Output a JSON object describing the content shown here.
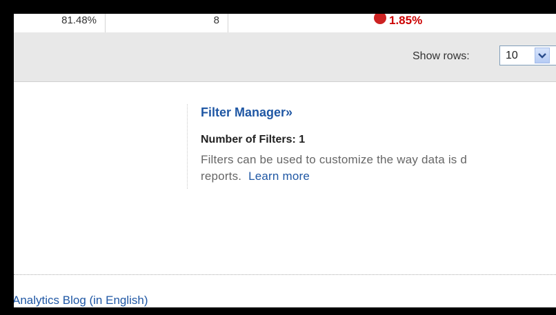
{
  "table_row": {
    "col1_value": "81.48%",
    "col2_value": "8",
    "col3_value": "1.85%",
    "col3_color": "#cc0000"
  },
  "pager": {
    "show_rows_label": "Show rows:",
    "rows_value": "10"
  },
  "filter_manager": {
    "title": "Filter Manager»",
    "count_label": "Number of Filters: 1",
    "description": "Filters can be used to customize the way data is d",
    "description_line2": "reports.",
    "learn_more": "Learn more"
  },
  "footer": {
    "blog_link": "Analytics Blog (in English)"
  },
  "colors": {
    "link": "#1f57a4",
    "bar_bg": "#e8e8e8"
  }
}
